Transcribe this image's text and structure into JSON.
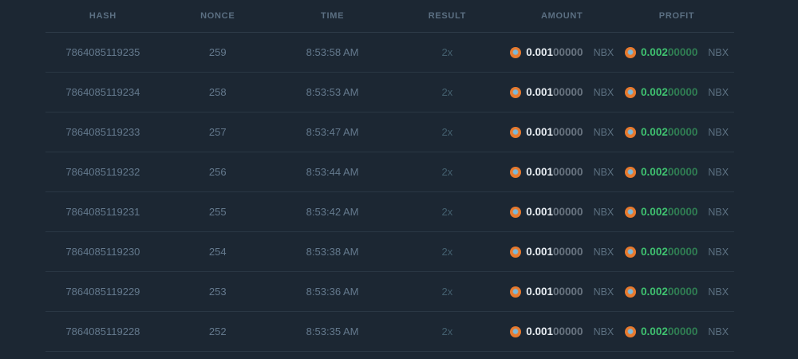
{
  "table": {
    "columns": [
      {
        "key": "hash",
        "label": "HASH"
      },
      {
        "key": "nonce",
        "label": "NONCE"
      },
      {
        "key": "time",
        "label": "TIME"
      },
      {
        "key": "result",
        "label": "RESULT"
      },
      {
        "key": "amount",
        "label": "AMOUNT"
      },
      {
        "key": "profit",
        "label": "PROFIT"
      }
    ],
    "currency": "NBX",
    "rows": [
      {
        "hash": "7864085119235",
        "nonce": "259",
        "time": "8:53:58 AM",
        "result": "2x",
        "amount_main": "0.001",
        "amount_zeros": "00000",
        "profit_main": "0.002",
        "profit_zeros": "00000"
      },
      {
        "hash": "7864085119234",
        "nonce": "258",
        "time": "8:53:53 AM",
        "result": "2x",
        "amount_main": "0.001",
        "amount_zeros": "00000",
        "profit_main": "0.002",
        "profit_zeros": "00000"
      },
      {
        "hash": "7864085119233",
        "nonce": "257",
        "time": "8:53:47 AM",
        "result": "2x",
        "amount_main": "0.001",
        "amount_zeros": "00000",
        "profit_main": "0.002",
        "profit_zeros": "00000"
      },
      {
        "hash": "7864085119232",
        "nonce": "256",
        "time": "8:53:44 AM",
        "result": "2x",
        "amount_main": "0.001",
        "amount_zeros": "00000",
        "profit_main": "0.002",
        "profit_zeros": "00000"
      },
      {
        "hash": "7864085119231",
        "nonce": "255",
        "time": "8:53:42 AM",
        "result": "2x",
        "amount_main": "0.001",
        "amount_zeros": "00000",
        "profit_main": "0.002",
        "profit_zeros": "00000"
      },
      {
        "hash": "7864085119230",
        "nonce": "254",
        "time": "8:53:38 AM",
        "result": "2x",
        "amount_main": "0.001",
        "amount_zeros": "00000",
        "profit_main": "0.002",
        "profit_zeros": "00000"
      },
      {
        "hash": "7864085119229",
        "nonce": "253",
        "time": "8:53:36 AM",
        "result": "2x",
        "amount_main": "0.001",
        "amount_zeros": "00000",
        "profit_main": "0.002",
        "profit_zeros": "00000"
      },
      {
        "hash": "7864085119228",
        "nonce": "252",
        "time": "8:53:35 AM",
        "result": "2x",
        "amount_main": "0.001",
        "amount_zeros": "00000",
        "profit_main": "0.002",
        "profit_zeros": "00000"
      }
    ]
  },
  "colors": {
    "background": "#1c2733",
    "separator": "#2a3744",
    "muted_text": "#64798d",
    "header_text": "#5b6f82",
    "amount_white": "#e9eef3",
    "zeros_gray": "#697480",
    "profit_green": "#3fc270",
    "profit_green_dim": "#2f7d52",
    "coin_orange": "#e87a2e",
    "coin_center_blue": "#7db8d8"
  }
}
